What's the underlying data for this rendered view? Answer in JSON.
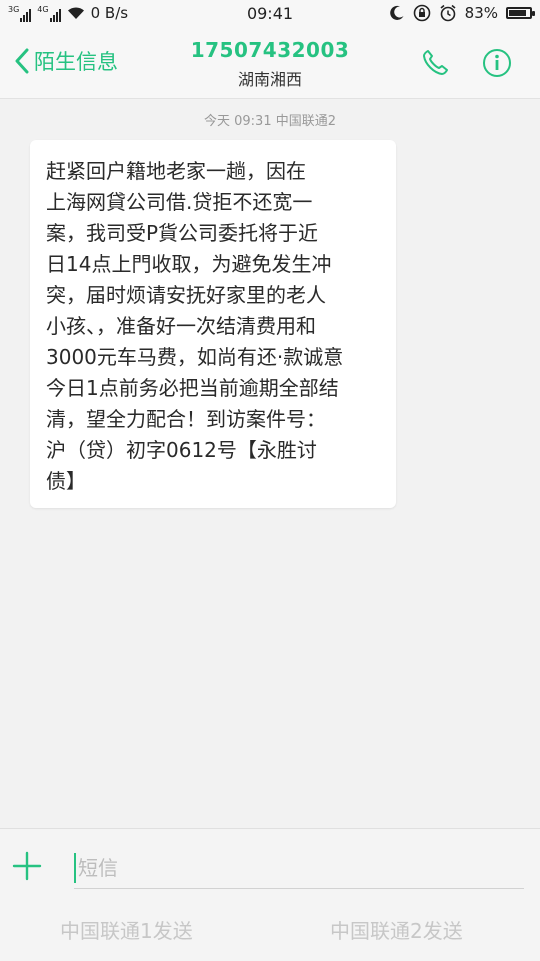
{
  "status_bar": {
    "net1": "3G",
    "net2": "4G",
    "speed": "0 B/s",
    "time": "09:41",
    "battery": "83%",
    "battery_level": 0.83
  },
  "header": {
    "back_label": "陌生信息",
    "number": "17507432003",
    "region": "湖南湘西"
  },
  "conversation": {
    "timestamp": "今天 09:31  中国联通2",
    "messages": [
      {
        "text": " 赶紧回户籍地老家一趟，因在\n上海网貸公司借.贷拒不还宽一\n案，我司受P貨公司委托将于近\n日14点上門收取，为避免发生冲\n突，届时烦请安抚好家里的老人\n小孩、，准备好一次结清费用和\n3000元车马费，如尚有还·款诚意\n今日1点前务必把当前逾期全部结\n清，望全力配合！到访案件号：\n沪（贷）初字0612号【永胜讨\n债】"
      }
    ]
  },
  "composer": {
    "placeholder": "短信",
    "send1_label": "中国联通1发送",
    "send2_label": "中国联通2发送"
  },
  "colors": {
    "accent": "#26c281",
    "background": "#f2f2f2",
    "bubble": "#ffffff"
  }
}
